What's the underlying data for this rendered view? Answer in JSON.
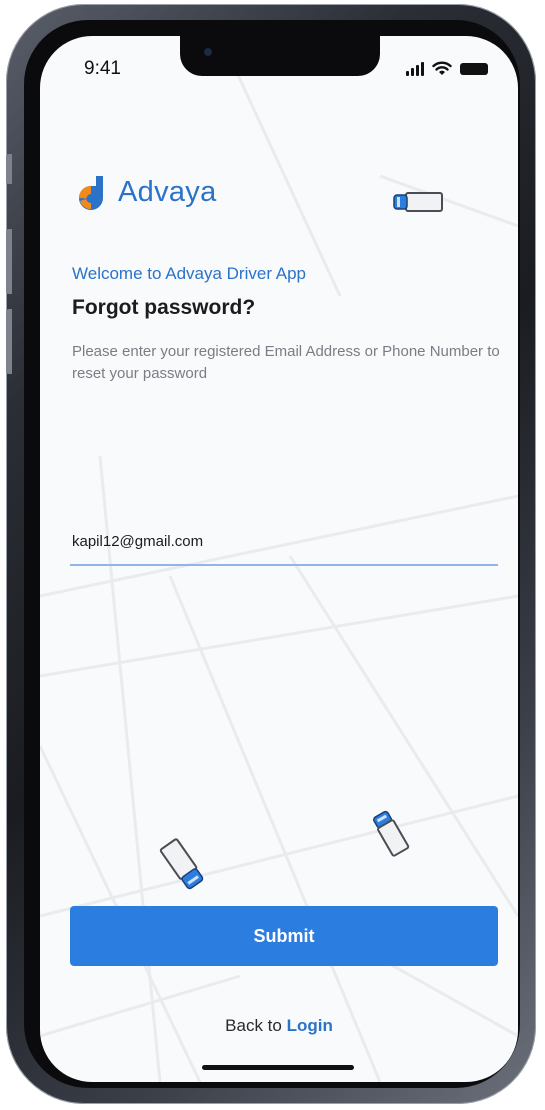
{
  "status_bar": {
    "time": "9:41"
  },
  "brand": {
    "name": "Advaya",
    "accent_color": "#2b72c9",
    "mark_colors": [
      "#2b72c9",
      "#f28a1a"
    ]
  },
  "header": {
    "welcome": "Welcome to Advaya Driver App",
    "title": "Forgot password?",
    "instructions": "Please enter your registered Email Address or Phone Number to reset your password"
  },
  "form": {
    "email_value": "kapil12@gmail.com",
    "submit_label": "Submit",
    "submit_color": "#2b7de0"
  },
  "footer": {
    "back_prefix": "Back to ",
    "login_label": "Login"
  },
  "icons": [
    "app-logo-icon",
    "signal-icon",
    "wifi-icon",
    "battery-icon",
    "truck-icon"
  ]
}
